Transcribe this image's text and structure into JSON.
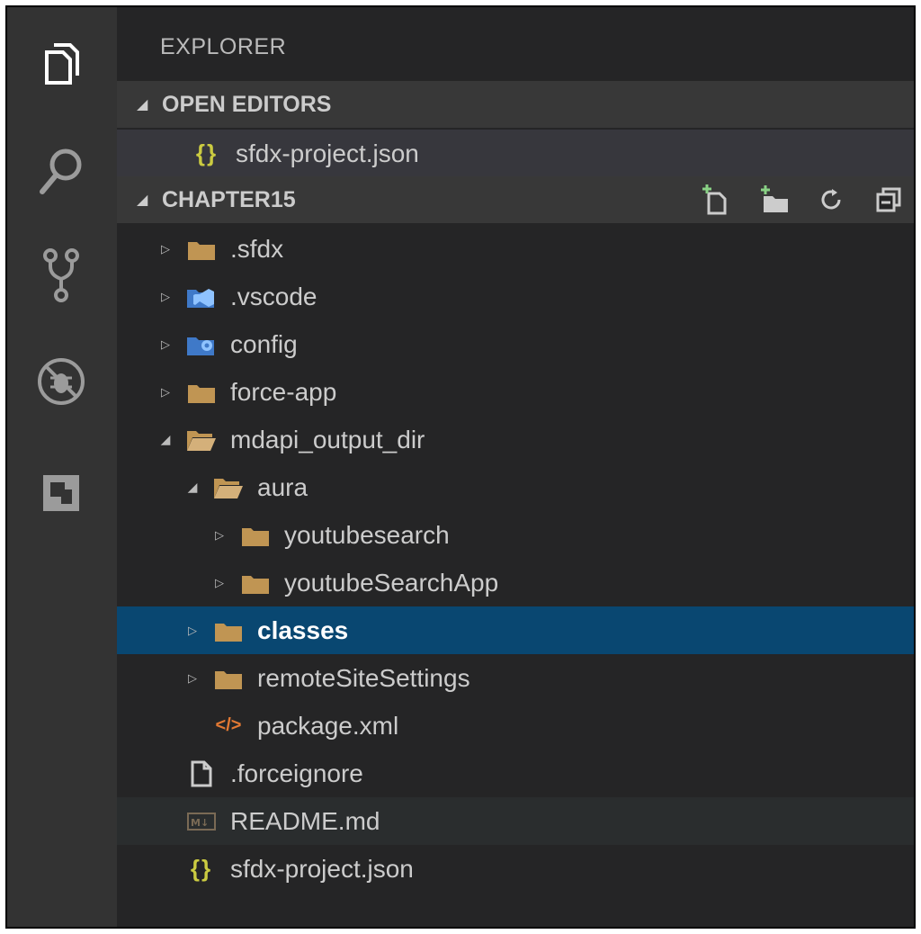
{
  "explorer": {
    "title": "EXPLORER"
  },
  "open_editors": {
    "header": "OPEN EDITORS",
    "items": [
      {
        "label": "sfdx-project.json",
        "icon": "json-braces-icon"
      }
    ]
  },
  "project": {
    "header": "CHAPTER15",
    "actions": [
      "new-file-icon",
      "new-folder-icon",
      "refresh-icon",
      "collapse-all-icon"
    ]
  },
  "tree": [
    {
      "label": ".sfdx",
      "icon": "folder-icon",
      "depth": 0,
      "twisty": "collapsed"
    },
    {
      "label": ".vscode",
      "icon": "vscode-folder-icon",
      "depth": 0,
      "twisty": "collapsed"
    },
    {
      "label": "config",
      "icon": "config-folder-icon",
      "depth": 0,
      "twisty": "collapsed"
    },
    {
      "label": "force-app",
      "icon": "folder-icon",
      "depth": 0,
      "twisty": "collapsed"
    },
    {
      "label": "mdapi_output_dir",
      "icon": "folder-open-icon",
      "depth": 0,
      "twisty": "expanded"
    },
    {
      "label": "aura",
      "icon": "folder-open-icon",
      "depth": 1,
      "twisty": "expanded"
    },
    {
      "label": "youtubesearch",
      "icon": "folder-icon",
      "depth": 2,
      "twisty": "collapsed"
    },
    {
      "label": "youtubeSearchApp",
      "icon": "folder-icon",
      "depth": 2,
      "twisty": "collapsed"
    },
    {
      "label": "classes",
      "icon": "folder-icon",
      "depth": 1,
      "twisty": "collapsed",
      "selected": true
    },
    {
      "label": "remoteSiteSettings",
      "icon": "folder-icon",
      "depth": 1,
      "twisty": "collapsed"
    },
    {
      "label": "package.xml",
      "icon": "xml-icon",
      "depth": 1,
      "twisty": "none"
    },
    {
      "label": ".forceignore",
      "icon": "file-icon",
      "depth": 0,
      "twisty": "none"
    },
    {
      "label": "README.md",
      "icon": "markdown-icon",
      "depth": 0,
      "twisty": "none",
      "hover": true
    },
    {
      "label": "sfdx-project.json",
      "icon": "json-braces-icon",
      "depth": 0,
      "twisty": "none"
    }
  ],
  "colors": {
    "sidebar_bg": "#252526",
    "activity_bg": "#333333",
    "selection_bg": "#094771",
    "folder": "#c09553",
    "json": "#cbcb41",
    "xml": "#e37933"
  }
}
